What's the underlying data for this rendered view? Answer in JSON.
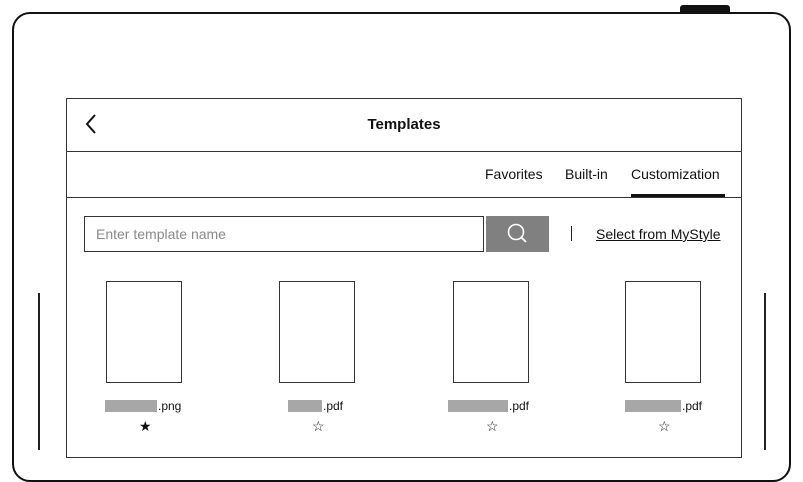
{
  "header": {
    "title": "Templates",
    "back_icon": "chevron-left-icon"
  },
  "tabs": [
    {
      "label": "Favorites",
      "active": false
    },
    {
      "label": "Built-in",
      "active": false
    },
    {
      "label": "Customization",
      "active": true
    }
  ],
  "search": {
    "placeholder": "Enter template name",
    "value": "",
    "button_icon": "search-icon"
  },
  "mystyle_link": "Select from MyStyle",
  "templates": [
    {
      "extension": ".png",
      "favorite_icon": "★",
      "favorite": true
    },
    {
      "extension": ".pdf",
      "favorite_icon": "☆",
      "favorite": false
    },
    {
      "extension": ".pdf",
      "favorite_icon": "☆",
      "favorite": false
    },
    {
      "extension": ".pdf",
      "favorite_icon": "☆",
      "favorite": false
    }
  ],
  "colors": {
    "redaction": "#a7a7a7",
    "search_button": "#808080"
  }
}
